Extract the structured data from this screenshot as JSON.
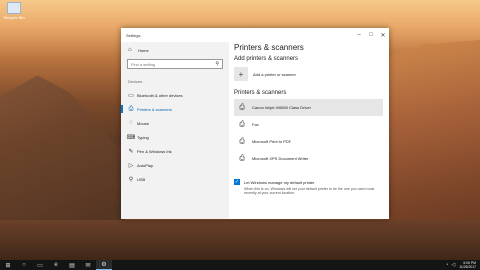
{
  "desktop": {
    "icon_label": "Recycle Bin"
  },
  "window": {
    "title": "Settings",
    "controls": {
      "minimize": "–",
      "maximize": "□",
      "close": "✕"
    }
  },
  "sidebar": {
    "home_label": "Home",
    "search_placeholder": "Find a setting",
    "section_label": "Devices",
    "items": [
      {
        "label": "Bluetooth & other devices",
        "icon": "▭"
      },
      {
        "label": "Printers & scanners",
        "icon": "⎙"
      },
      {
        "label": "Mouse",
        "icon": "◌"
      },
      {
        "label": "Typing",
        "icon": "⌨"
      },
      {
        "label": "Pen & Windows Ink",
        "icon": "✎"
      },
      {
        "label": "AutoPlay",
        "icon": "▷"
      },
      {
        "label": "USB",
        "icon": "⚲"
      }
    ]
  },
  "content": {
    "page_title": "Printers & scanners",
    "add_heading": "Add printers & scanners",
    "add_button_label": "Add a printer or scanner",
    "list_heading": "Printers & scanners",
    "printers": [
      {
        "name": "Canon Inkjet iX6800 Class Driver"
      },
      {
        "name": "Fax"
      },
      {
        "name": "Microsoft Print to PDF"
      },
      {
        "name": "Microsoft XPS Document Writer"
      }
    ],
    "default_checkbox_label": "Let Windows manage my default printer",
    "default_hint": "When this is on, Windows will set your default printer to be the one you used most recently at your current location."
  },
  "taskbar": {
    "items": [
      "⊞",
      "○",
      "▭",
      "e",
      "▤",
      "✉",
      "⚙"
    ],
    "clock_time": "6:06 PM",
    "clock_date": "11/26/2017"
  }
}
